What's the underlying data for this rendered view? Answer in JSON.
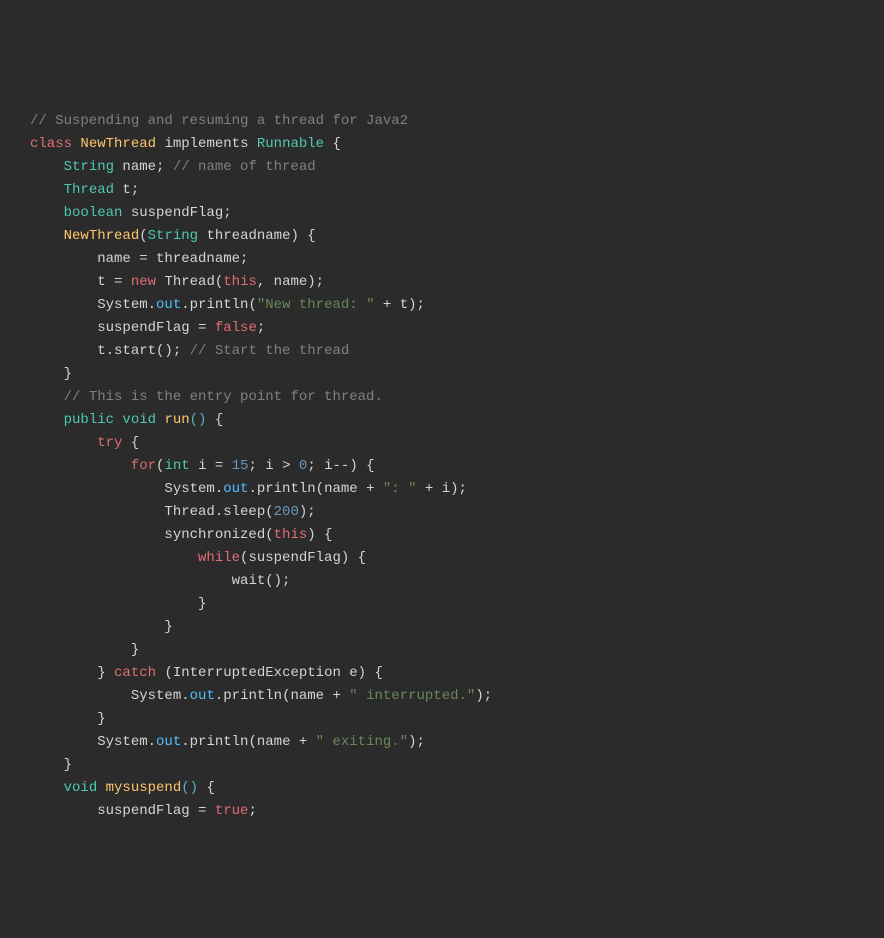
{
  "code": {
    "l1_comment": "// Suspending and resuming a thread for Java2",
    "l2_class": "class",
    "l2_NewThread": "NewThread",
    "l2_implements": "implements",
    "l2_Runnable": "Runnable",
    "l2_brace": " {",
    "l3_String": "String",
    "l3_name": " name; ",
    "l3_comment": "// name of thread",
    "l4": "Thread t;",
    "l4_Thread": "Thread",
    "l4_t": " t;",
    "l5_boolean": "boolean",
    "l5_rest": " suspendFlag;",
    "l6_NewThread": "NewThread",
    "l6_paren": "(",
    "l6_String": "String",
    "l6_rest": " threadname) {",
    "l7": "name = threadname;",
    "l8_t": "t = ",
    "l8_new": "new",
    "l8_Thread": " Thread(",
    "l8_this": "this",
    "l8_rest": ", name);",
    "l9_a": "System.",
    "l9_out": "out",
    "l9_b": ".println(",
    "l9_str": "\"New thread: \"",
    "l9_c": " + t);",
    "l10_a": "suspendFlag = ",
    "l10_false": "false",
    "l10_b": ";",
    "l11_a": "t.start(); ",
    "l11_comment": "// Start the thread",
    "l12": "}",
    "l13_comment": "// This is the entry point for thread.",
    "l14_public": "public",
    "l14_void": " void",
    "l14_run": " run",
    "l14_paren": "()",
    "l14_brace": " {",
    "l15_try": "try",
    "l15_brace": " {",
    "l16_for": "for",
    "l16_a": "(",
    "l16_int": "int",
    "l16_b": " i = ",
    "l16_15": "15",
    "l16_c": "; i > ",
    "l16_0": "0",
    "l16_d": "; i--) {",
    "l17_a": "System.",
    "l17_out": "out",
    "l17_b": ".println(name + ",
    "l17_str": "\": \"",
    "l17_c": " + i);",
    "l18_a": "Thread.sleep(",
    "l18_200": "200",
    "l18_b": ");",
    "l19_a": "synchronized(",
    "l19_this": "this",
    "l19_b": ") {",
    "l20_while": "while",
    "l20_a": "(suspendFlag) {",
    "l21": "wait();",
    "l22": "}",
    "l23": "}",
    "l24": "}",
    "l25_a": "} ",
    "l25_catch": "catch",
    "l25_b": " (InterruptedException e) {",
    "l26_a": "System.",
    "l26_out": "out",
    "l26_b": ".println(name + ",
    "l26_str": "\" interrupted.\"",
    "l26_c": ");",
    "l27": "}",
    "l28_a": "System.",
    "l28_out": "out",
    "l28_b": ".println(name + ",
    "l28_str": "\" exiting.\"",
    "l28_c": ");",
    "l29": "}",
    "l30_void": "void",
    "l30_fn": " mysuspend",
    "l30_paren": "()",
    "l30_brace": " {",
    "l31_a": "suspendFlag = ",
    "l31_true": "true",
    "l31_b": ";"
  }
}
